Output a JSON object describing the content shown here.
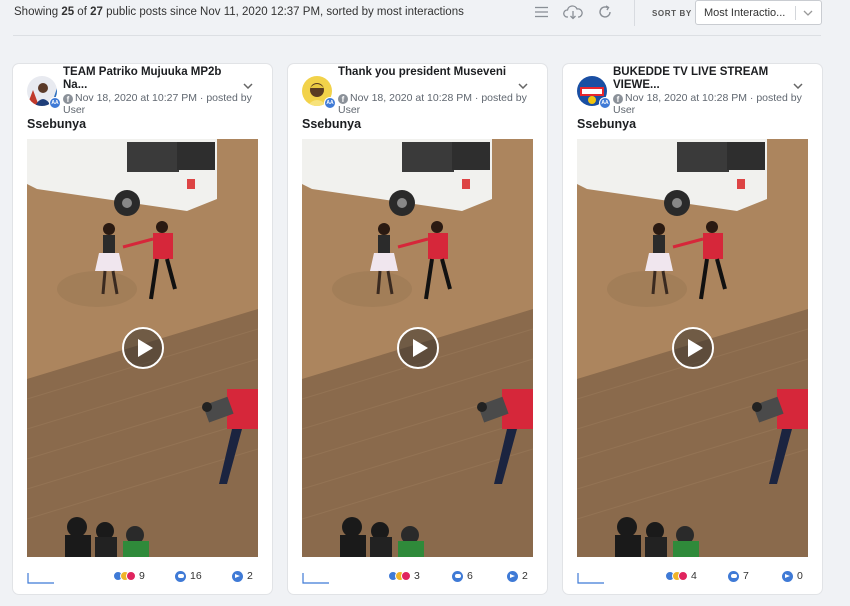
{
  "summary": {
    "prefix": "Showing ",
    "shown": "25",
    "of": " of ",
    "total": "27",
    "suffix": " public posts since Nov 11, 2020 12:37 PM, sorted by most interactions"
  },
  "toolbar": {
    "list_icon": "list-icon",
    "download_icon": "cloud-download-icon",
    "refresh_icon": "refresh-icon",
    "sort_label": "SORT BY",
    "sort_value": "Most Interactio..."
  },
  "colors": {
    "accent": "#3f7ad6",
    "background": "#f0f2f5",
    "card": "#ffffff"
  },
  "posts": [
    {
      "account_name": "TEAM Patriko Mujuuka MP2b Na...",
      "timestamp": "Nov 18, 2020 at 10:27 PM",
      "posted_by": " · posted by",
      "user": "User",
      "text": "Ssebunya",
      "reactions": "9",
      "comments": "16",
      "shares": "2"
    },
    {
      "account_name": "Thank you president Museveni",
      "timestamp": "Nov 18, 2020 at 10:28 PM",
      "posted_by": " · posted by",
      "user": "User",
      "text": "Ssebunya",
      "reactions": "3",
      "comments": "6",
      "shares": "2"
    },
    {
      "account_name": "BUKEDDE TV LIVE STREAM VIEWE...",
      "timestamp": "Nov 18, 2020 at 10:28 PM",
      "posted_by": " · posted by",
      "user": "User",
      "text": "Ssebunya",
      "reactions": "4",
      "comments": "7",
      "shares": "0"
    }
  ]
}
